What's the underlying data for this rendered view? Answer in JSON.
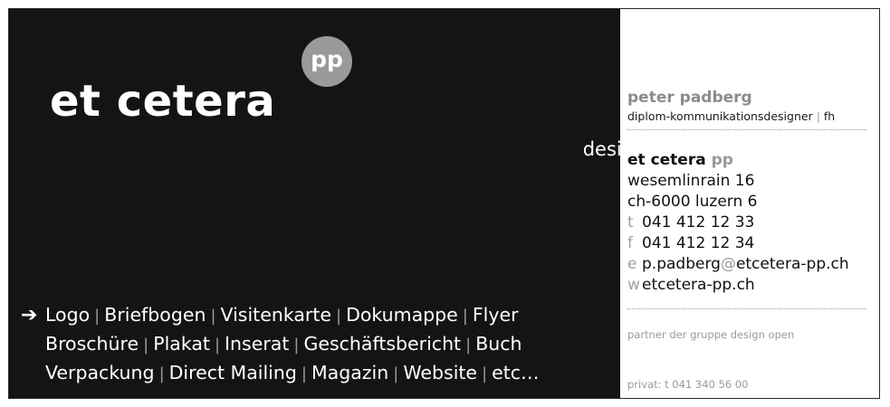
{
  "left": {
    "brand": "et cetera",
    "badge": "pp",
    "tagline": "design for communication",
    "arrow": "➔",
    "services": [
      [
        "Logo",
        "Briefbogen",
        "Visitenkarte",
        "Dokumappe",
        "Flyer"
      ],
      [
        "Broschüre",
        "Plakat",
        "Inserat",
        "Geschäftsbericht",
        "Buch"
      ],
      [
        "Verpackung",
        "Direct Mailing",
        "Magazin",
        "Website",
        "etc…"
      ]
    ],
    "separator": "|"
  },
  "right": {
    "name": "peter padberg",
    "title_main": "diplom-kommunikationsdesigner",
    "title_sep": "|",
    "title_suffix": "fh",
    "company_name": "et cetera",
    "company_pp": "pp",
    "street": "wesemlinrain 16",
    "city": "ch-6000 luzern 6",
    "phone_label": "t",
    "phone": "041 412 12 33",
    "fax_label": "f",
    "fax": "041 412 12 34",
    "email_label": "e",
    "email_user": "p.padberg",
    "email_at": "@",
    "email_domain": "etcetera-pp.ch",
    "web_label": "w",
    "web": "etcetera-pp.ch",
    "partner": "partner der gruppe design open",
    "privat": "privat: t 041 340 56 00"
  }
}
